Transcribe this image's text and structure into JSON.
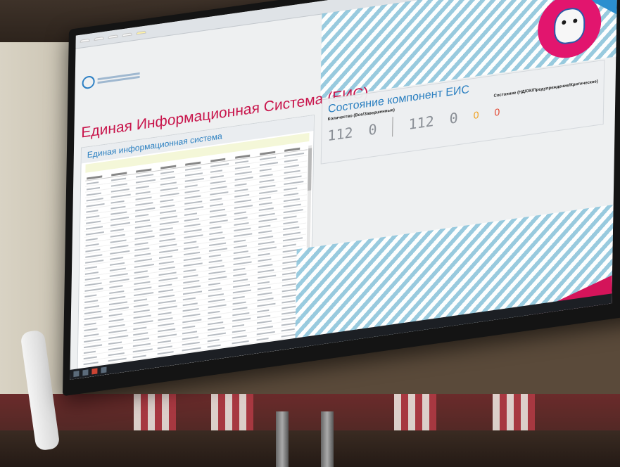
{
  "browser": {
    "corner_icons": "? ▣ ⧉ ×"
  },
  "header": {
    "title": "Единая Информационная Система (ЕИС)"
  },
  "left_panel": {
    "title": "Единая информационная система"
  },
  "status_panel": {
    "title": "Состояние компонент ЕИС",
    "quantity_label": "Количество (Все/Завершенные)",
    "state_label": "Состояние (НД/ОК/Предупреждение/Критическое)",
    "total": "112",
    "completed": "0",
    "state_nd": "112",
    "state_ok": "0",
    "state_warning": "0",
    "state_critical": "0"
  },
  "colors": {
    "title_red": "#c8144b",
    "accent_blue": "#2a7fc0",
    "warning": "#f0a01c",
    "critical": "#e2452f"
  }
}
